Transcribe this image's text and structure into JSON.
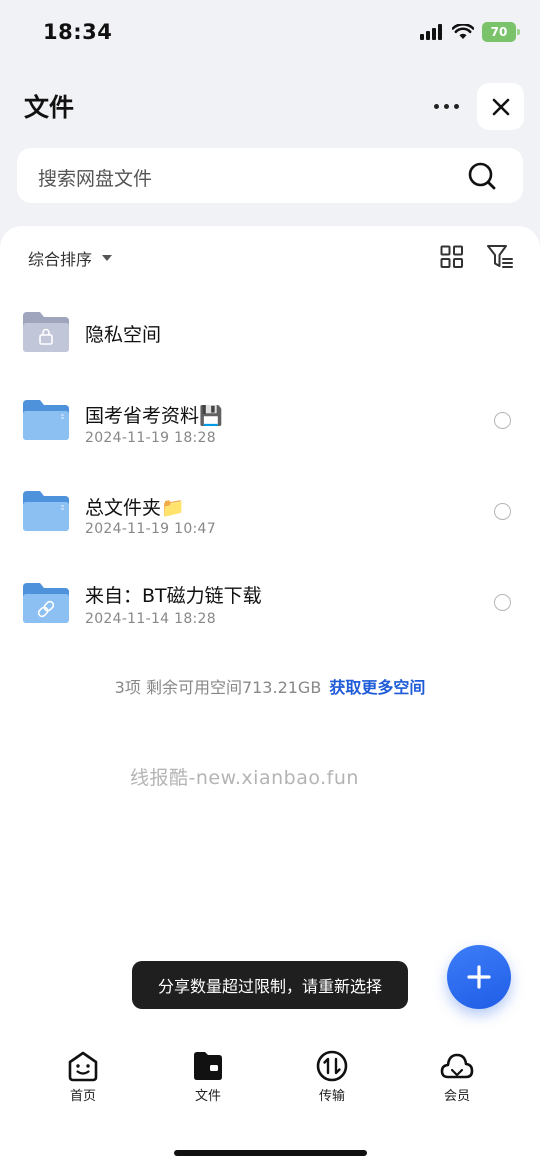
{
  "status_bar": {
    "time": "18:34",
    "battery": "70"
  },
  "header": {
    "title": "文件"
  },
  "search": {
    "placeholder": "搜索网盘文件"
  },
  "toolbar": {
    "sort_label": "综合排序"
  },
  "files": [
    {
      "name": "隐私空间",
      "date": "",
      "type": "private-folder"
    },
    {
      "name": "国考省考资料💾",
      "date": "2024-11-19 18:28",
      "type": "folder"
    },
    {
      "name": "总文件夹📁",
      "date": "2024-11-19 10:47",
      "type": "folder"
    },
    {
      "name": "来自：BT磁力链下载",
      "date": "2024-11-14 18:28",
      "type": "link-folder"
    }
  ],
  "storage": {
    "summary": "3项 剩余可用空间713.21GB",
    "link": "获取更多空间"
  },
  "watermark": "线报酷-new.xianbao.fun",
  "toast": "分享数量超过限制，请重新选择",
  "tabbar": {
    "items": [
      {
        "label": "首页",
        "icon": "home-face-icon"
      },
      {
        "label": "文件",
        "icon": "wallet-folder-icon"
      },
      {
        "label": "传输",
        "icon": "transfer-icon"
      },
      {
        "label": "会员",
        "icon": "cloud-icon"
      }
    ]
  },
  "colors": {
    "accent": "#1e5bd8",
    "fab": "#2f6ef0",
    "folder": "#5fa3e8",
    "private_folder": "#aab0c6"
  }
}
